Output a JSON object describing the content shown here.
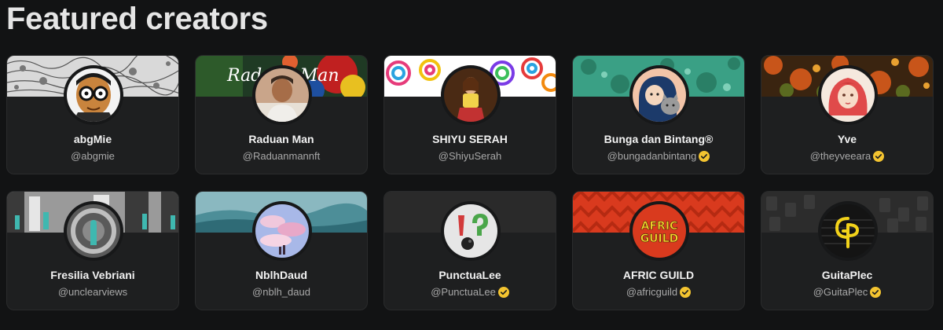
{
  "section": {
    "title": "Featured creators"
  },
  "colors": {
    "background": "#121314",
    "card": "#1e1f20",
    "verified": "#f4c430"
  },
  "creators": [
    {
      "name": "abgMie",
      "handle": "@abgmie",
      "verified": false,
      "avatar_icon": "cartoon-face-glasses"
    },
    {
      "name": "Raduan Man",
      "handle": "@Raduanmannft",
      "verified": false,
      "avatar_icon": "portrait-man",
      "banner_text": "Raduan Man"
    },
    {
      "name": "SHIYU SERAH",
      "handle": "@ShiyuSerah",
      "verified": false,
      "avatar_icon": "portrait-woman"
    },
    {
      "name": "Bunga dan Bintang®",
      "handle": "@bungadanbintang",
      "verified": true,
      "avatar_icon": "illustration-girl-cat"
    },
    {
      "name": "Yve",
      "handle": "@theyveeara",
      "verified": true,
      "avatar_icon": "illustration-red-hair-girl"
    },
    {
      "name": "Fresilia Vebriani",
      "handle": "@unclearviews",
      "verified": false,
      "avatar_icon": "bw-photo"
    },
    {
      "name": "NblhDaud",
      "handle": "@nblh_daud",
      "verified": false,
      "avatar_icon": "sunset-sky"
    },
    {
      "name": "PunctuaLee",
      "handle": "@PunctuaLee",
      "verified": true,
      "avatar_icon": "punctuation-marks"
    },
    {
      "name": "AFRIC GUILD",
      "handle": "@africguild",
      "verified": true,
      "avatar_icon": "afric-guild-logo",
      "logo_text": "AFRIC GUILD"
    },
    {
      "name": "GuitaPlec",
      "handle": "@GuitaPlec",
      "verified": true,
      "avatar_icon": "gp-monogram"
    }
  ]
}
